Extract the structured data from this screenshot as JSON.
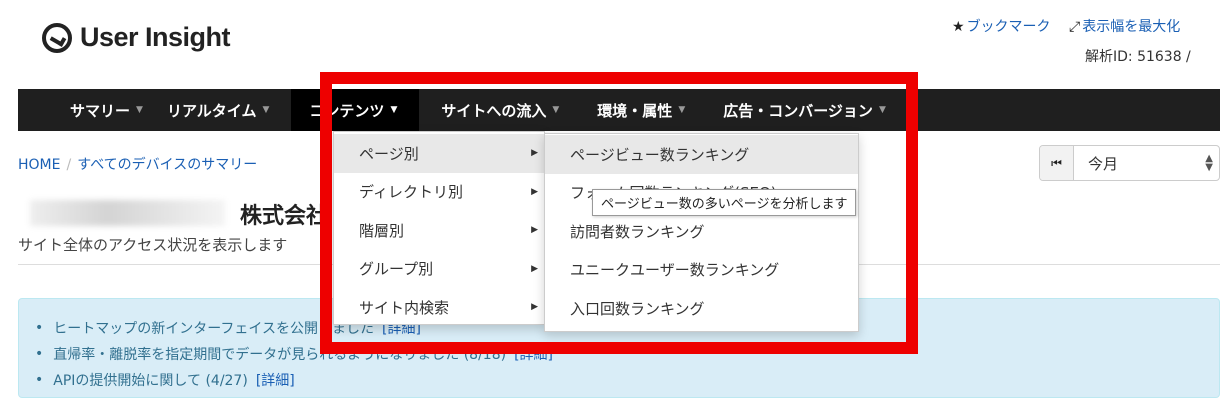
{
  "header": {
    "logo_text": "User Insight",
    "bookmark_label": "ブックマーク",
    "expand_label": "表示幅を最大化",
    "analysis_id": "解析ID: 51638 /"
  },
  "nav": {
    "items": [
      {
        "label": "サマリー"
      },
      {
        "label": "リアルタイム"
      },
      {
        "label": "コンテンツ"
      },
      {
        "label": "サイトへの流入"
      },
      {
        "label": "環境・属性"
      },
      {
        "label": "広告・コンバージョン"
      }
    ]
  },
  "breadcrumb": {
    "home": "HOME",
    "current": "すべてのデバイスのサマリー"
  },
  "period": {
    "value": "今月"
  },
  "page": {
    "company": "株式会社",
    "subtitle": "サイト全体のアクセス状況を表示します"
  },
  "dropdown": {
    "items": [
      {
        "label": "ページ別"
      },
      {
        "label": "ディレクトリ別"
      },
      {
        "label": "階層別"
      },
      {
        "label": "グループ別"
      },
      {
        "label": "サイト内検索"
      }
    ]
  },
  "submenu": {
    "items": [
      {
        "label": "ページビュー数ランキング"
      },
      {
        "label": "フォーム回数ランキング(SEO)"
      },
      {
        "label": "訪問者数ランキング"
      },
      {
        "label": "ユニークユーザー数ランキング"
      },
      {
        "label": "入口回数ランキング"
      }
    ]
  },
  "tooltip": {
    "text": "ページビュー数の多いページを分析します"
  },
  "notices": {
    "items": [
      {
        "text": "ヒートマップの新インターフェイスを公開しました",
        "link": "[詳細]"
      },
      {
        "text": "直帰率・離脱率を指定期間でデータが見られるようになりました (8/18)",
        "link": "[詳細]"
      },
      {
        "text": "APIの提供開始に関して (4/27)",
        "link": "[詳細]"
      }
    ]
  }
}
